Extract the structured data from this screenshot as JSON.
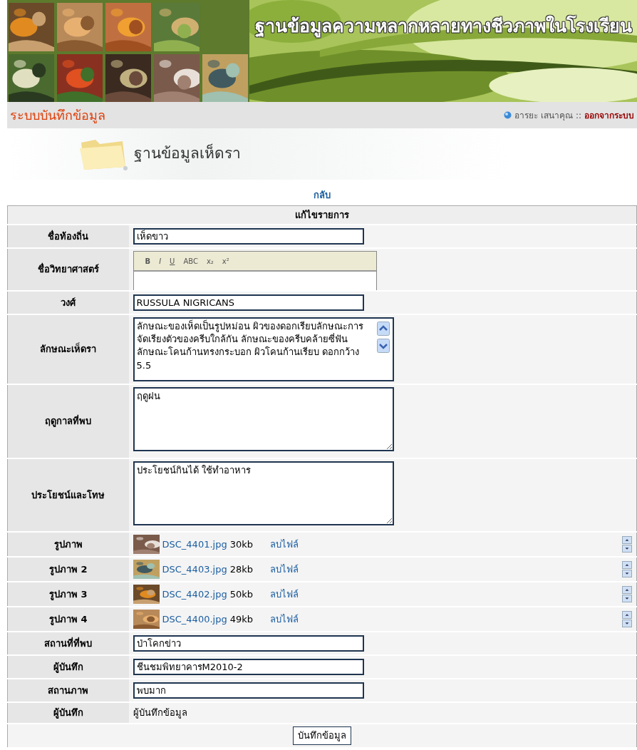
{
  "header": {
    "title": "ฐานข้อมูลความหลากหลายทางชีวภาพในโรงเรียน"
  },
  "system_bar": {
    "title": "ระบบบันทึกข้อมูล",
    "user": "อารยะ เสนาคุณ ::",
    "logout": "ออกจากระบบ"
  },
  "section_title": "ฐานข้อมูลเห็ดรา",
  "back_link": "กลับ",
  "form": {
    "heading": "แก้ไขรายการ",
    "rows": [
      {
        "label": "ชื่อท้องถิ่น",
        "kind": "text",
        "value": "เห็ดขาว"
      },
      {
        "label": "ชื่อวิทยาศาสตร์",
        "kind": "editor",
        "toolbar": [
          "B",
          "I",
          "U",
          "ABC",
          "x₂",
          "x²"
        ]
      },
      {
        "label": "วงศ์",
        "kind": "text",
        "value": "RUSSULA NIGRICANS"
      },
      {
        "label": "ลักษณะเห็ดรา",
        "kind": "textarea",
        "value": "ลักษณะของเห็ดเป็นรูปหม่อน ผิวของดอกเรียบลักษณะการจัดเรียงตัวของครีบใกล้กัน ลักษณะของครีบคล้ายซี่ฟัน ลักษณะโคนก้านทรงกระบอก ผิวโคนก้านเรียบ ดอกกว้าง 5.5",
        "scrollbar": true
      },
      {
        "label": "ฤดูกาลที่พบ",
        "kind": "textarea",
        "value": "ฤดูฝน"
      },
      {
        "label": "ประโยชน์และโทษ",
        "kind": "textarea",
        "value": "ประโยชน์กินได้ ใช้ทำอาหาร"
      },
      {
        "label": "รูปภาพ",
        "kind": "file",
        "file_name": "DSC_4401.jpg",
        "size": "30kb",
        "delete_label": "ลบไฟล์"
      },
      {
        "label": "รูปภาพ 2",
        "kind": "file",
        "file_name": "DSC_4403.jpg",
        "size": "28kb",
        "delete_label": "ลบไฟล์"
      },
      {
        "label": "รูปภาพ 3",
        "kind": "file",
        "file_name": "DSC_4402.jpg",
        "size": "50kb",
        "delete_label": "ลบไฟล์"
      },
      {
        "label": "รูปภาพ 4",
        "kind": "file",
        "file_name": "DSC_4400.jpg",
        "size": "49kb",
        "delete_label": "ลบไฟล์"
      },
      {
        "label": "สถานที่ที่พบ",
        "kind": "text",
        "value": "ป่าโคกข่าว"
      },
      {
        "label": "ผู้บันทึก",
        "kind": "text",
        "value": "ชีนชมพิทยาคารM2010-2"
      },
      {
        "label": "สถานภาพ",
        "kind": "text",
        "value": "พบมาก"
      },
      {
        "label": "ผู้บันทึก",
        "kind": "static",
        "value": "ผู้บันทึกข้อมูล"
      }
    ],
    "submit": "บันทึกข้อมูล"
  }
}
